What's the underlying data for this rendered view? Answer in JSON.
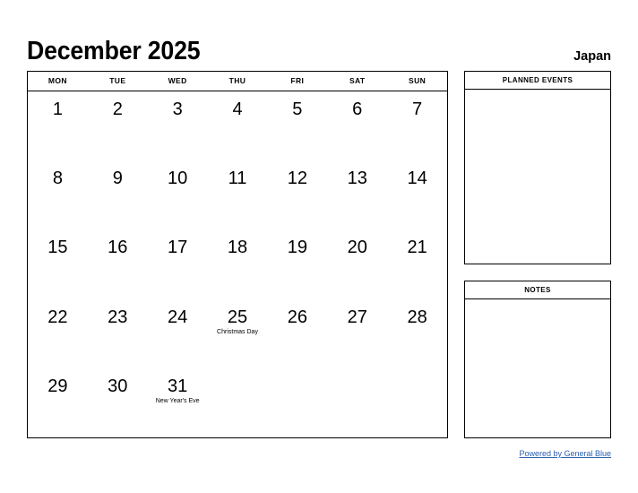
{
  "header": {
    "title": "December 2025",
    "country": "Japan"
  },
  "calendar": {
    "weekdays": [
      "MON",
      "TUE",
      "WED",
      "THU",
      "FRI",
      "SAT",
      "SUN"
    ],
    "weeks": [
      [
        {
          "num": "1",
          "event": ""
        },
        {
          "num": "2",
          "event": ""
        },
        {
          "num": "3",
          "event": ""
        },
        {
          "num": "4",
          "event": ""
        },
        {
          "num": "5",
          "event": ""
        },
        {
          "num": "6",
          "event": ""
        },
        {
          "num": "7",
          "event": ""
        }
      ],
      [
        {
          "num": "8",
          "event": ""
        },
        {
          "num": "9",
          "event": ""
        },
        {
          "num": "10",
          "event": ""
        },
        {
          "num": "11",
          "event": ""
        },
        {
          "num": "12",
          "event": ""
        },
        {
          "num": "13",
          "event": ""
        },
        {
          "num": "14",
          "event": ""
        }
      ],
      [
        {
          "num": "15",
          "event": ""
        },
        {
          "num": "16",
          "event": ""
        },
        {
          "num": "17",
          "event": ""
        },
        {
          "num": "18",
          "event": ""
        },
        {
          "num": "19",
          "event": ""
        },
        {
          "num": "20",
          "event": ""
        },
        {
          "num": "21",
          "event": ""
        }
      ],
      [
        {
          "num": "22",
          "event": ""
        },
        {
          "num": "23",
          "event": ""
        },
        {
          "num": "24",
          "event": ""
        },
        {
          "num": "25",
          "event": "Christmas Day"
        },
        {
          "num": "26",
          "event": ""
        },
        {
          "num": "27",
          "event": ""
        },
        {
          "num": "28",
          "event": ""
        }
      ],
      [
        {
          "num": "29",
          "event": ""
        },
        {
          "num": "30",
          "event": ""
        },
        {
          "num": "31",
          "event": "New Year's Eve"
        },
        {
          "num": "",
          "event": ""
        },
        {
          "num": "",
          "event": ""
        },
        {
          "num": "",
          "event": ""
        },
        {
          "num": "",
          "event": ""
        }
      ]
    ]
  },
  "panels": {
    "planned_events": {
      "title": "PLANNED EVENTS",
      "content": ""
    },
    "notes": {
      "title": "NOTES",
      "content": ""
    }
  },
  "footer": {
    "link_label": "Powered by General Blue",
    "link_color": "#2b5fb0"
  }
}
